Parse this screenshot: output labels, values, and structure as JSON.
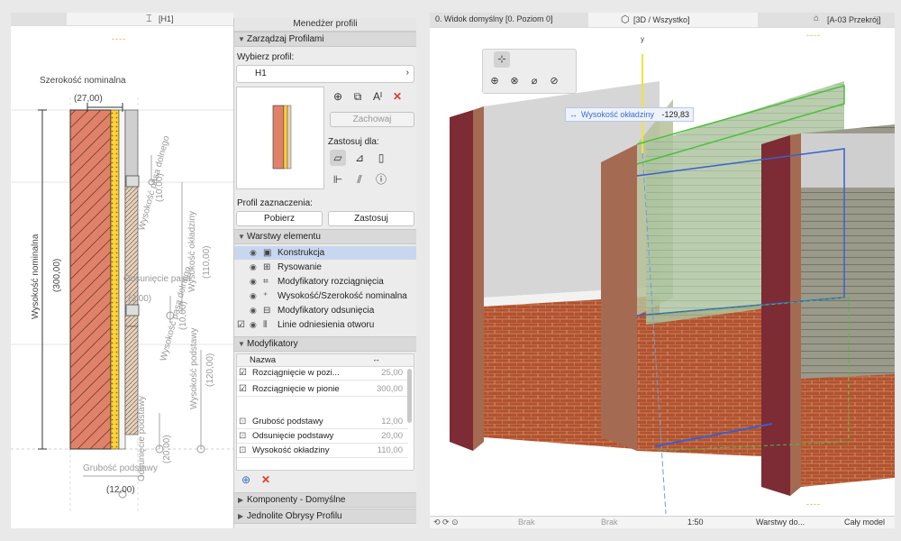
{
  "left_view": {
    "tab_label": "[H1]",
    "marker": "----",
    "dims": {
      "nominal_width_label": "Szerokość nominalna",
      "nominal_width_value": "(27,00)",
      "nominal_height_label": "Wysokość nominalna",
      "nominal_height_value": "(300,00)",
      "lower_belt_height_1": "Wysokość pasa dolnego",
      "lower_belt_height_1_value": "(10,00)",
      "cladding_height": "Wysokość okładziny",
      "cladding_height_value": "(110,00)",
      "belt_offset": "Odsunięcie pasa",
      "belt_offset_value": "(3,00)",
      "lower_belt_height_2": "Wysokość pasa dolnego",
      "lower_belt_height_2_value": "(10,00)",
      "base_height": "Wysokość podstawy",
      "base_height_value": "(120,00)",
      "base_offset": "Odsunięcie podstawy",
      "base_offset_value": "(20,00)",
      "base_thickness": "Grubość podstawy",
      "base_thickness_value": "(12,00)"
    }
  },
  "profile_manager": {
    "title": "Menedżer profili",
    "manage_section": "Zarządzaj Profilami",
    "choose_profile_label": "Wybierz profil:",
    "selected_profile": "H1",
    "save_button": "Zachowaj",
    "apply_for_label": "Zastosuj dla:",
    "selection_profile_label": "Profil zaznaczenia:",
    "get_button": "Pobierz",
    "apply_button": "Zastosuj",
    "layers_section": "Warstwy elementu",
    "layers": [
      {
        "label": "Konstrukcja",
        "checked": false,
        "selected": true
      },
      {
        "label": "Rysowanie",
        "checked": false,
        "selected": false
      },
      {
        "label": "Modyfikatory rozciągnięcia",
        "checked": false,
        "selected": false
      },
      {
        "label": "Wysokość/Szerokość nominalna",
        "checked": false,
        "selected": false
      },
      {
        "label": "Modyfikatory odsunięcia",
        "checked": false,
        "selected": false
      },
      {
        "label": "Linie odniesienia otworu",
        "checked": true,
        "selected": false
      }
    ],
    "modifiers_section": "Modyfikatory",
    "modifiers_col_name": "Nazwa",
    "modifiers": [
      {
        "name": "Rozciągnięcie w pozi...",
        "value": "25,00",
        "checked": true
      },
      {
        "name": "Rozciągnięcie w pionie",
        "value": "300,00",
        "checked": true
      },
      {
        "name": "Grubość podstawy",
        "value": "12,00",
        "checked": false
      },
      {
        "name": "Odsunięcie podstawy",
        "value": "20,00",
        "checked": false
      },
      {
        "name": "Wysokość okładziny",
        "value": "110,00",
        "checked": false
      }
    ],
    "components_section": "Komponenty - Domyślne",
    "outline_section": "Jednolite Obrysy Profilu"
  },
  "view3d": {
    "tab_left": "0. Widok domyślny [0. Poziom 0]",
    "tab_center": "[3D / Wszystko]",
    "tab_right": "[A-03 Przekrój]",
    "marker": "----",
    "axis_label": "y",
    "tooltip_label": "Wysokość okładziny",
    "tooltip_value": "-129,83",
    "status": {
      "s1": "Brak",
      "s2": "Brak",
      "scale": "1:50",
      "layers": "Warstwy do...",
      "model": "Cały model"
    }
  }
}
